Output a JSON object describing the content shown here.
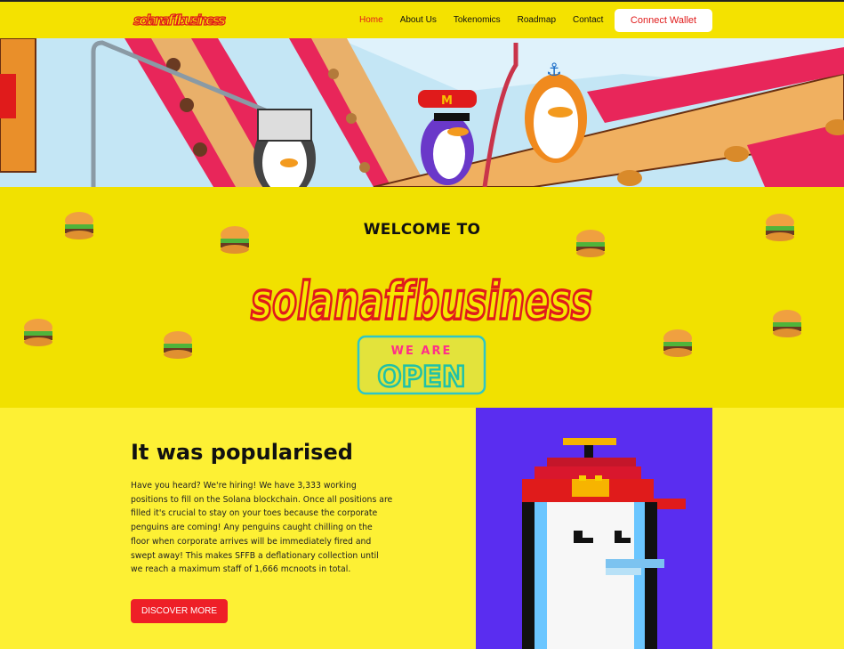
{
  "nav": {
    "logo_text": "solanaffbusiness",
    "links": [
      {
        "label": "Home",
        "active": true
      },
      {
        "label": "About Us",
        "active": false
      },
      {
        "label": "Tokenomics",
        "active": false
      },
      {
        "label": "Roadmap",
        "active": false
      },
      {
        "label": "Contact",
        "active": false
      }
    ],
    "connect_label": "Connect Wallet"
  },
  "welcome": {
    "title": "WELCOME TO",
    "logo_text": "solanaffbusiness",
    "sign_top": "WE ARE",
    "sign_bottom": "OPEN"
  },
  "about": {
    "title": "It was popularised",
    "body": "Have you heard? We're hiring! We have 3,333 working positions to fill on the Solana blockchain. Once all positions are filled it's crucial to stay on your toes because the corporate penguins are coming! Any penguins caught chilling on the floor when corporate arrives will be immediately fired and swept away! This makes SFFB a deflationary collection until we reach a maximum staff of 1,666 mcnoots in total.",
    "button_label": "DISCOVER MORE"
  },
  "colors": {
    "yellow": "#f1e100",
    "red": "#e01b1b",
    "purple": "#5a2df0"
  }
}
